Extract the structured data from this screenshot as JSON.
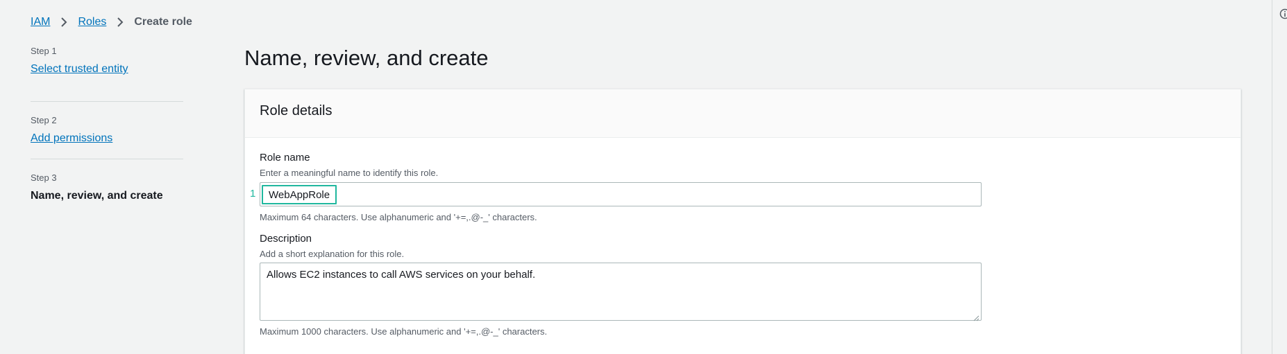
{
  "breadcrumb": {
    "items": [
      {
        "label": "IAM"
      },
      {
        "label": "Roles"
      }
    ],
    "current": "Create role"
  },
  "wizard": {
    "steps": [
      {
        "step": "Step 1",
        "label": "Select trusted entity",
        "state": "link"
      },
      {
        "step": "Step 2",
        "label": "Add permissions",
        "state": "link"
      },
      {
        "step": "Step 3",
        "label": "Name, review, and create",
        "state": "current"
      }
    ]
  },
  "main": {
    "title": "Name, review, and create"
  },
  "role_details": {
    "heading": "Role details",
    "role_name": {
      "label": "Role name",
      "description": "Enter a meaningful name to identify this role.",
      "value": "WebAppRole",
      "marker": "1",
      "constraint": "Maximum 64 characters. Use alphanumeric and '+=,.@-_' characters."
    },
    "description": {
      "label": "Description",
      "description": "Add a short explanation for this role.",
      "value": "Allows EC2 instances to call AWS services on your behalf.",
      "constraint": "Maximum 1000 characters. Use alphanumeric and '+=,.@-_' characters."
    }
  },
  "colors": {
    "link": "#0073bb",
    "highlight": "#1fb79e",
    "background": "#f2f3f3"
  },
  "icons": [
    "chevron-right-icon",
    "info-icon",
    "resize-grip-icon"
  ]
}
